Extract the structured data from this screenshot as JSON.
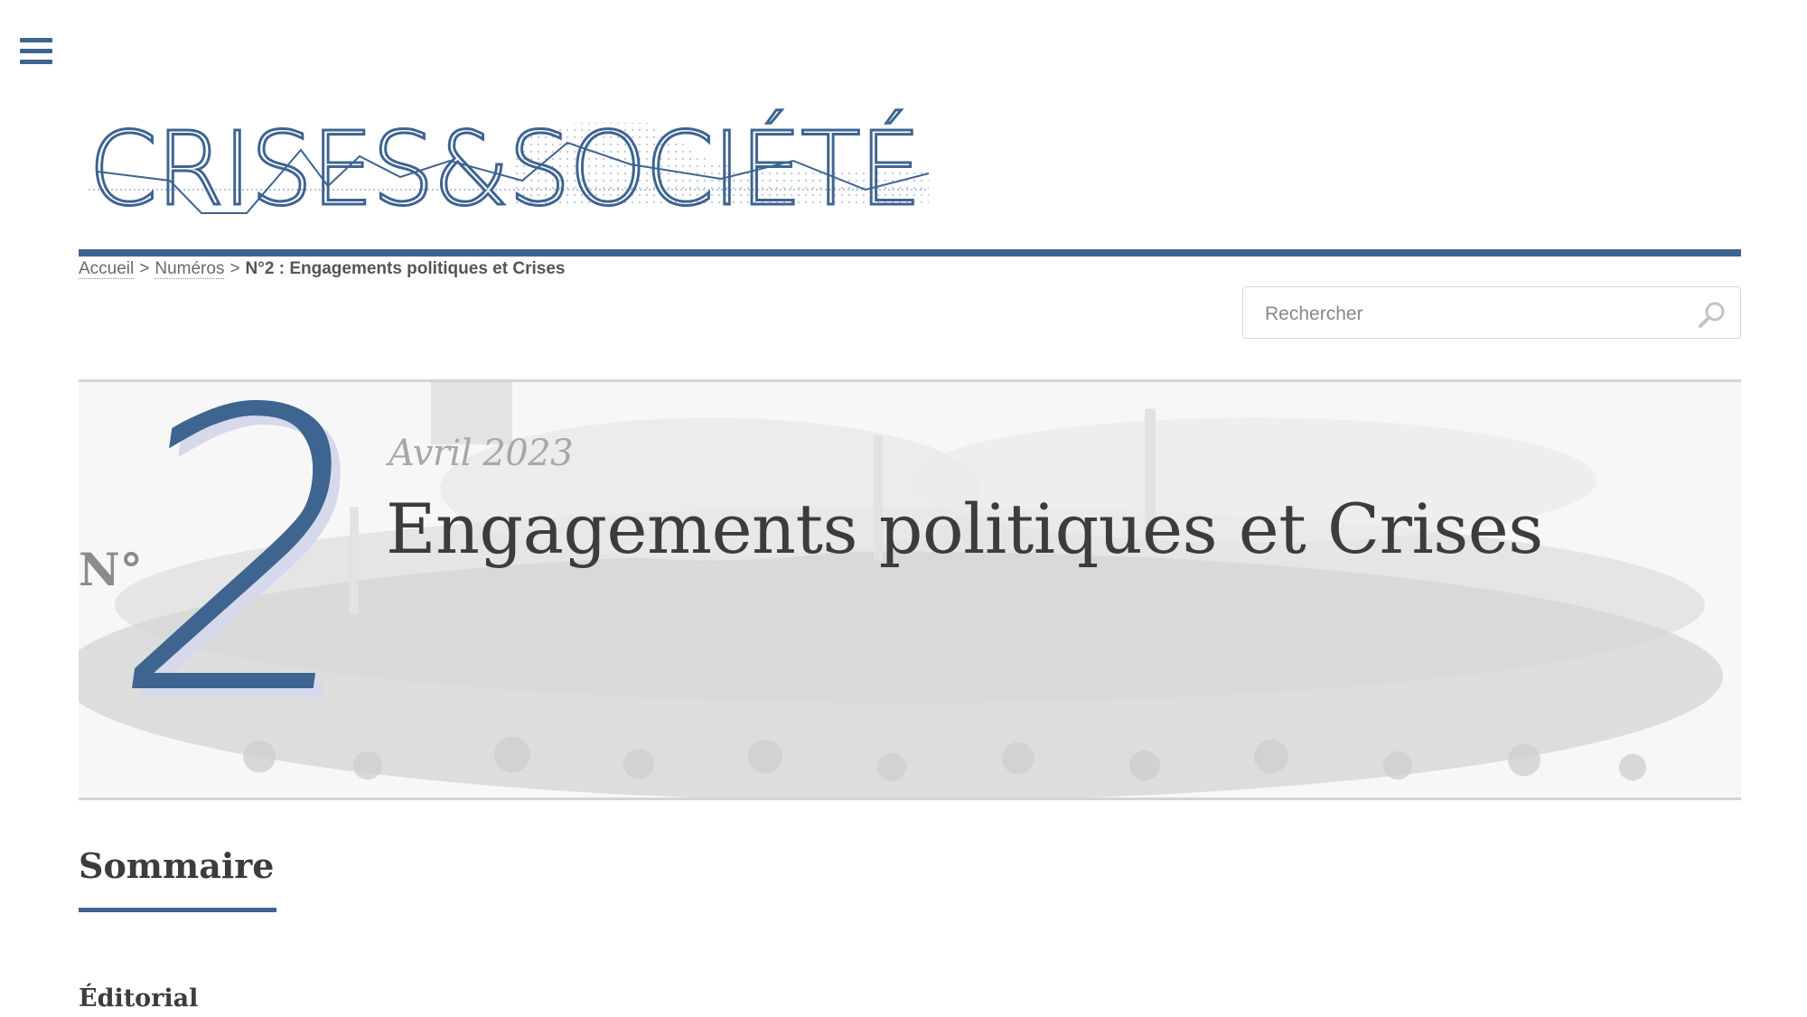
{
  "nav": {
    "menu_icon": "hamburger-menu-icon"
  },
  "site": {
    "logo_text": "CRISES&SOCIÉTÉ",
    "accent_color": "#3e6490"
  },
  "breadcrumb": {
    "home": "Accueil",
    "sep1": ">",
    "issues": "Numéros",
    "sep2": ">",
    "current": "N°2 : Engagements politiques et Crises"
  },
  "search": {
    "placeholder": "Rechercher",
    "value": "",
    "icon": "search-icon"
  },
  "issue": {
    "number_prefix": "N°",
    "number": "2",
    "date": "Avril 2023",
    "title": "Engagements politiques et Crises"
  },
  "content": {
    "section_title": "Sommaire",
    "first_heading": "Éditorial"
  }
}
